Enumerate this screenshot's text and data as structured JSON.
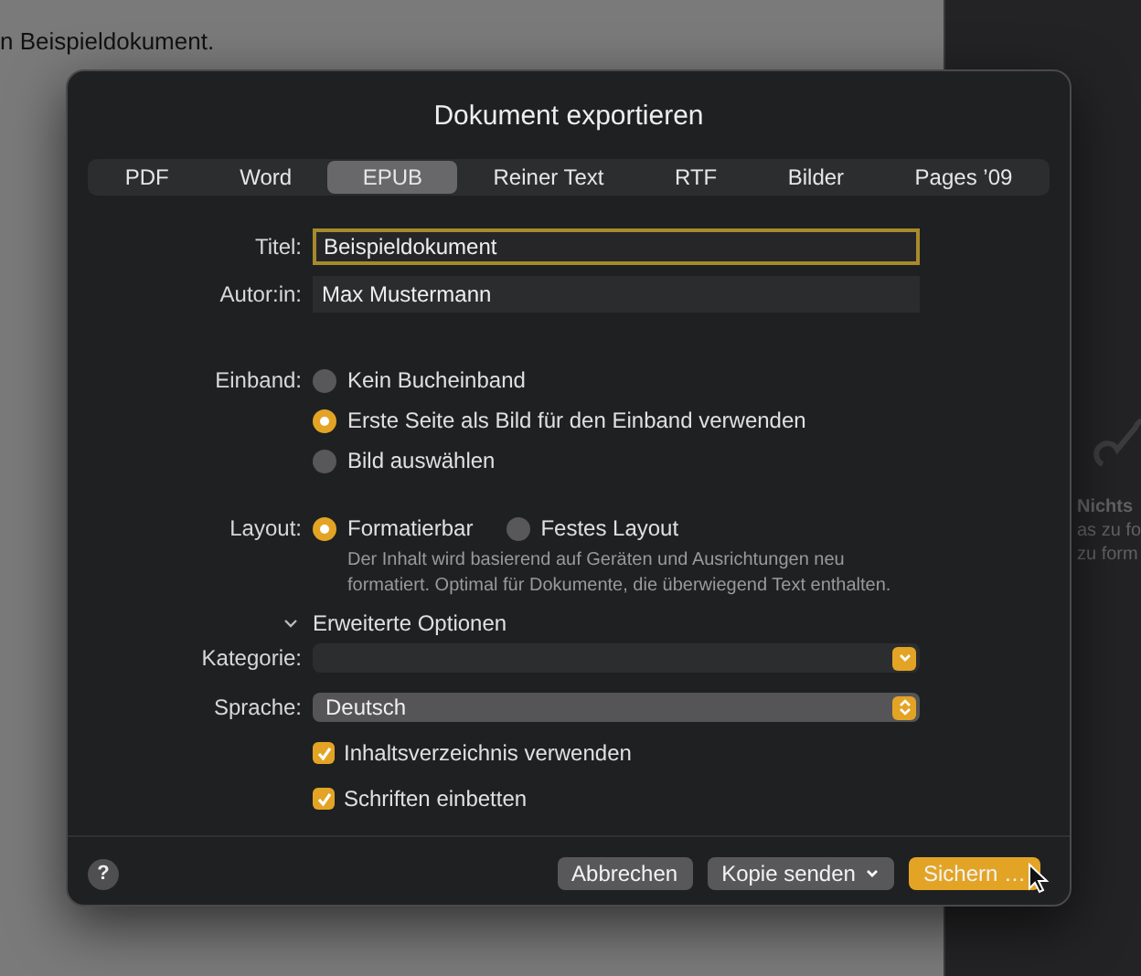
{
  "background": {
    "document_text": "n Beispieldokument.",
    "sidebar_lines": [
      {
        "text": "Nichts",
        "bold": true
      },
      {
        "text": "as zu fo",
        "bold": false
      },
      {
        "text": "zu form",
        "bold": false
      }
    ]
  },
  "dialog": {
    "title": "Dokument exportieren",
    "tabs": [
      {
        "label": "PDF",
        "selected": false
      },
      {
        "label": "Word",
        "selected": false
      },
      {
        "label": "EPUB",
        "selected": true
      },
      {
        "label": "Reiner Text",
        "selected": false
      },
      {
        "label": "RTF",
        "selected": false
      },
      {
        "label": "Bilder",
        "selected": false
      },
      {
        "label": "Pages ’09",
        "selected": false
      }
    ],
    "fields": [
      {
        "label": "Titel:",
        "value": "Beispieldokument",
        "focused": true
      },
      {
        "label": "Autor:in:",
        "value": "Max Mustermann",
        "focused": false
      }
    ],
    "cover": {
      "label": "Einband:",
      "options": [
        {
          "label": "Kein Bucheinband",
          "selected": false
        },
        {
          "label": "Erste Seite als Bild für den Einband verwenden",
          "selected": true
        },
        {
          "label": "Bild auswählen",
          "selected": false
        }
      ]
    },
    "layout": {
      "label": "Layout:",
      "options": [
        {
          "label": "Formatierbar",
          "selected": true
        },
        {
          "label": "Festes Layout",
          "selected": false
        }
      ],
      "description": "Der Inhalt wird basierend auf Geräten und Ausrichtungen neu formatiert. Optimal für Dokumente, die überwiegend Text enthalten."
    },
    "advanced": {
      "label": "Erweiterte Optionen",
      "expanded": true
    },
    "popups": [
      {
        "label": "Kategorie:",
        "kind": "pulldown"
      },
      {
        "label": "Sprache:",
        "value": "Deutsch",
        "kind": "stepper"
      }
    ],
    "checkboxes": [
      {
        "label": "Inhaltsverzeichnis verwenden",
        "checked": true
      },
      {
        "label": "Schriften einbetten",
        "checked": true
      }
    ],
    "help": "?",
    "buttons": [
      {
        "label": "Abbrechen",
        "kind": "plain"
      },
      {
        "label": "Kopie senden",
        "kind": "menu"
      },
      {
        "label": "Sichern …",
        "kind": "default"
      }
    ]
  }
}
